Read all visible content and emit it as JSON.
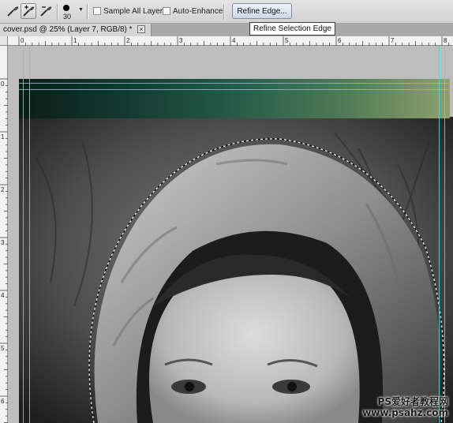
{
  "options_bar": {
    "tools": [
      {
        "name": "quick-selection-icon",
        "active": false
      },
      {
        "name": "quick-selection-add-icon",
        "active": true
      },
      {
        "name": "quick-selection-subtract-icon",
        "active": false
      }
    ],
    "brush_size": "30",
    "sample_all_layers": {
      "label": "Sample All Layers",
      "checked": false
    },
    "auto_enhance": {
      "label": "Auto-Enhance",
      "checked": false
    },
    "refine_edge_label": "Refine Edge...",
    "tooltip": "Refine Selection Edge"
  },
  "document_tab": {
    "title": "cover.psd @ 25% (Layer 7, RGB/8) *",
    "close_glyph": "×"
  },
  "rulers": {
    "horizontal_labels": [
      "0",
      "1",
      "2",
      "3",
      "4",
      "5",
      "6",
      "7",
      "8"
    ],
    "vertical_labels": [
      "0",
      "1",
      "2",
      "3",
      "4",
      "5",
      "6"
    ]
  },
  "colors": {
    "guide": "#4fd6d6",
    "selection_marquee": "#ffffff"
  },
  "watermark": {
    "line1": "PS爱好者教程网",
    "line2": "www.psahz.com"
  }
}
